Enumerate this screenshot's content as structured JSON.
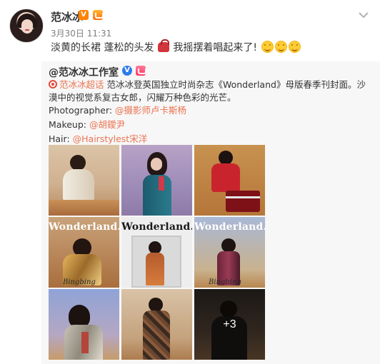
{
  "post": {
    "author": "范冰冰",
    "timestamp": "3月30日 11:31",
    "text_part1": "淡黄的长裙 蓬松的头发",
    "text_part2": "我摇摆着唱起来了!",
    "verified_badge": "V"
  },
  "repost": {
    "author": "@范冰冰工作室",
    "verified_badge": "V",
    "super_topic": "范冰冰超话",
    "body": " 范冰冰登英国独立时尚杂志《Wonderland》母版春季刊封面。沙漠中的视觉系复古女郎，闪耀万种色彩的光芒。",
    "credits": [
      {
        "label": "Photographer: ",
        "value": "@摄影师卢卡斯杨"
      },
      {
        "label": "Makeup: ",
        "value": "@胡鑀尹"
      },
      {
        "label": "Hair: ",
        "value": "@Hairstylest宋洋"
      }
    ],
    "photos": [
      {
        "alt": "photo-1"
      },
      {
        "alt": "photo-2"
      },
      {
        "alt": "photo-3"
      },
      {
        "alt": "photo-4",
        "magazine_title": "Wonderland.",
        "script": "Bingbing"
      },
      {
        "alt": "photo-5",
        "magazine_title": "Wonderland."
      },
      {
        "alt": "photo-6",
        "magazine_title": "Wonderland.",
        "script": "Bingbing"
      },
      {
        "alt": "photo-7"
      },
      {
        "alt": "photo-8"
      },
      {
        "alt": "photo-9",
        "more_count": "+3"
      }
    ]
  },
  "colors": {
    "link": "#eb7350",
    "repost_bg": "#f7f7f7",
    "orange_v": "#ff8200",
    "blue_v": "#2c7ce9"
  }
}
